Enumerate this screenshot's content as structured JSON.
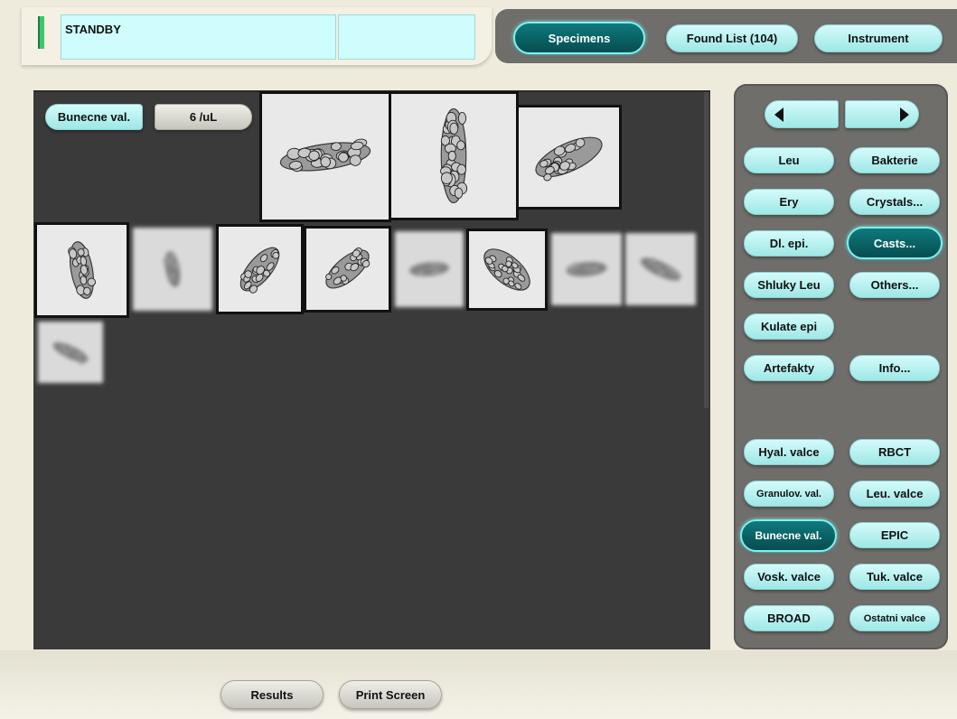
{
  "status": {
    "text": "STANDBY",
    "indicator_color": "#3cc86a"
  },
  "top_tabs": [
    {
      "label": "Specimens",
      "active": true
    },
    {
      "label": "Found List (104)",
      "active": false
    },
    {
      "label": "Instrument",
      "active": false
    }
  ],
  "gallery": {
    "category_label": "Bunecne val.",
    "concentration": "6 /uL",
    "images": [
      {
        "shape": "horizontal-cast",
        "state": "framed"
      },
      {
        "shape": "vertical-cast",
        "state": "framed"
      },
      {
        "shape": "diagonal-cast",
        "state": "framed"
      },
      {
        "shape": "vertical-cast-small",
        "state": "framed"
      },
      {
        "shape": "faint-blob",
        "state": "blurred"
      },
      {
        "shape": "curled-cast",
        "state": "framed"
      },
      {
        "shape": "diagonal-cast-dense",
        "state": "framed"
      },
      {
        "shape": "faint-horizontal",
        "state": "blurred"
      },
      {
        "shape": "diagonal-cast-large",
        "state": "framed"
      },
      {
        "shape": "faint-horizontal",
        "state": "blurred"
      },
      {
        "shape": "faint-diagonal",
        "state": "blurred"
      },
      {
        "shape": "faint-diagonal",
        "state": "blurred"
      }
    ]
  },
  "nav_arrows": {
    "prev": "left-arrow-icon",
    "next": "right-arrow-icon"
  },
  "categories": [
    {
      "label": "Leu",
      "active": false
    },
    {
      "label": "Bakterie",
      "active": false
    },
    {
      "label": "Ery",
      "active": false
    },
    {
      "label": "Crystals...",
      "active": false
    },
    {
      "label": "Dl. epi.",
      "active": false
    },
    {
      "label": "Casts...",
      "active": true
    },
    {
      "label": "Shluky Leu",
      "active": false
    },
    {
      "label": "Others...",
      "active": false
    },
    {
      "label": "Kulate epi",
      "active": false
    },
    {
      "label": "Artefakty",
      "active": false
    },
    {
      "label": "Info...",
      "active": false
    }
  ],
  "subcategories": [
    {
      "label": "Hyal. valce",
      "active": false
    },
    {
      "label": "RBCT",
      "active": false
    },
    {
      "label": "Granulov. val.",
      "active": false
    },
    {
      "label": "Leu. valce",
      "active": false
    },
    {
      "label": "Bunecne val.",
      "active": true
    },
    {
      "label": "EPIC",
      "active": false
    },
    {
      "label": "Vosk. valce",
      "active": false
    },
    {
      "label": "Tuk. valce",
      "active": false
    },
    {
      "label": "BROAD",
      "active": false
    },
    {
      "label": "Ostatni valce",
      "active": false
    }
  ],
  "footer": {
    "results_label": "Results",
    "print_label": "Print Screen"
  },
  "colors": {
    "panel_dark": "#3a3a3a",
    "nav_panel": "#6f6e6b",
    "accent_cyan": "#9ee8e6",
    "active_teal": "#0b6466"
  }
}
